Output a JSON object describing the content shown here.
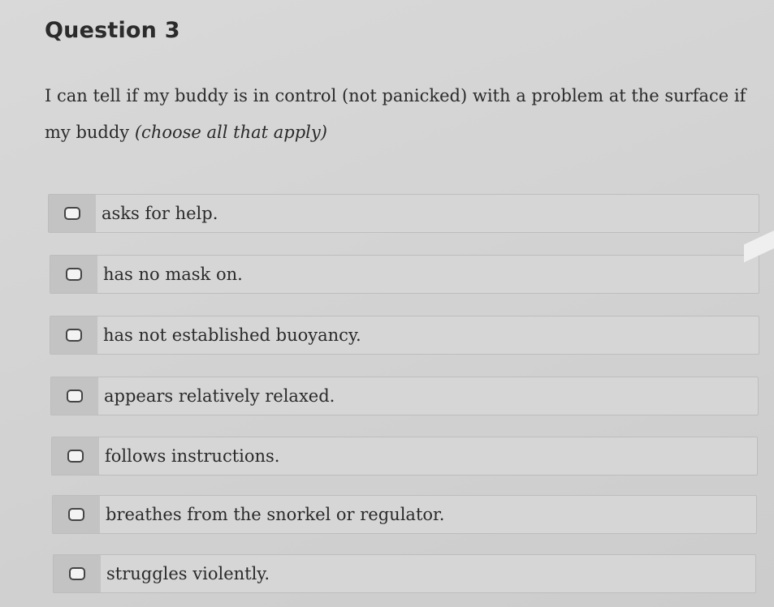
{
  "question": {
    "title": "Question 3",
    "prompt": "I can tell if my buddy is in control (not panicked) with a problem at the surface if my buddy ",
    "hint": "(choose all that apply)"
  },
  "options": [
    {
      "label": "asks for help.",
      "checked": false
    },
    {
      "label": "has no mask on.",
      "checked": false
    },
    {
      "label": "has not established buoyancy.",
      "checked": false
    },
    {
      "label": "appears relatively relaxed.",
      "checked": false
    },
    {
      "label": "follows instructions.",
      "checked": false
    },
    {
      "label": "breathes from the snorkel or regulator.",
      "checked": false
    },
    {
      "label": "struggles violently.",
      "checked": false
    }
  ]
}
